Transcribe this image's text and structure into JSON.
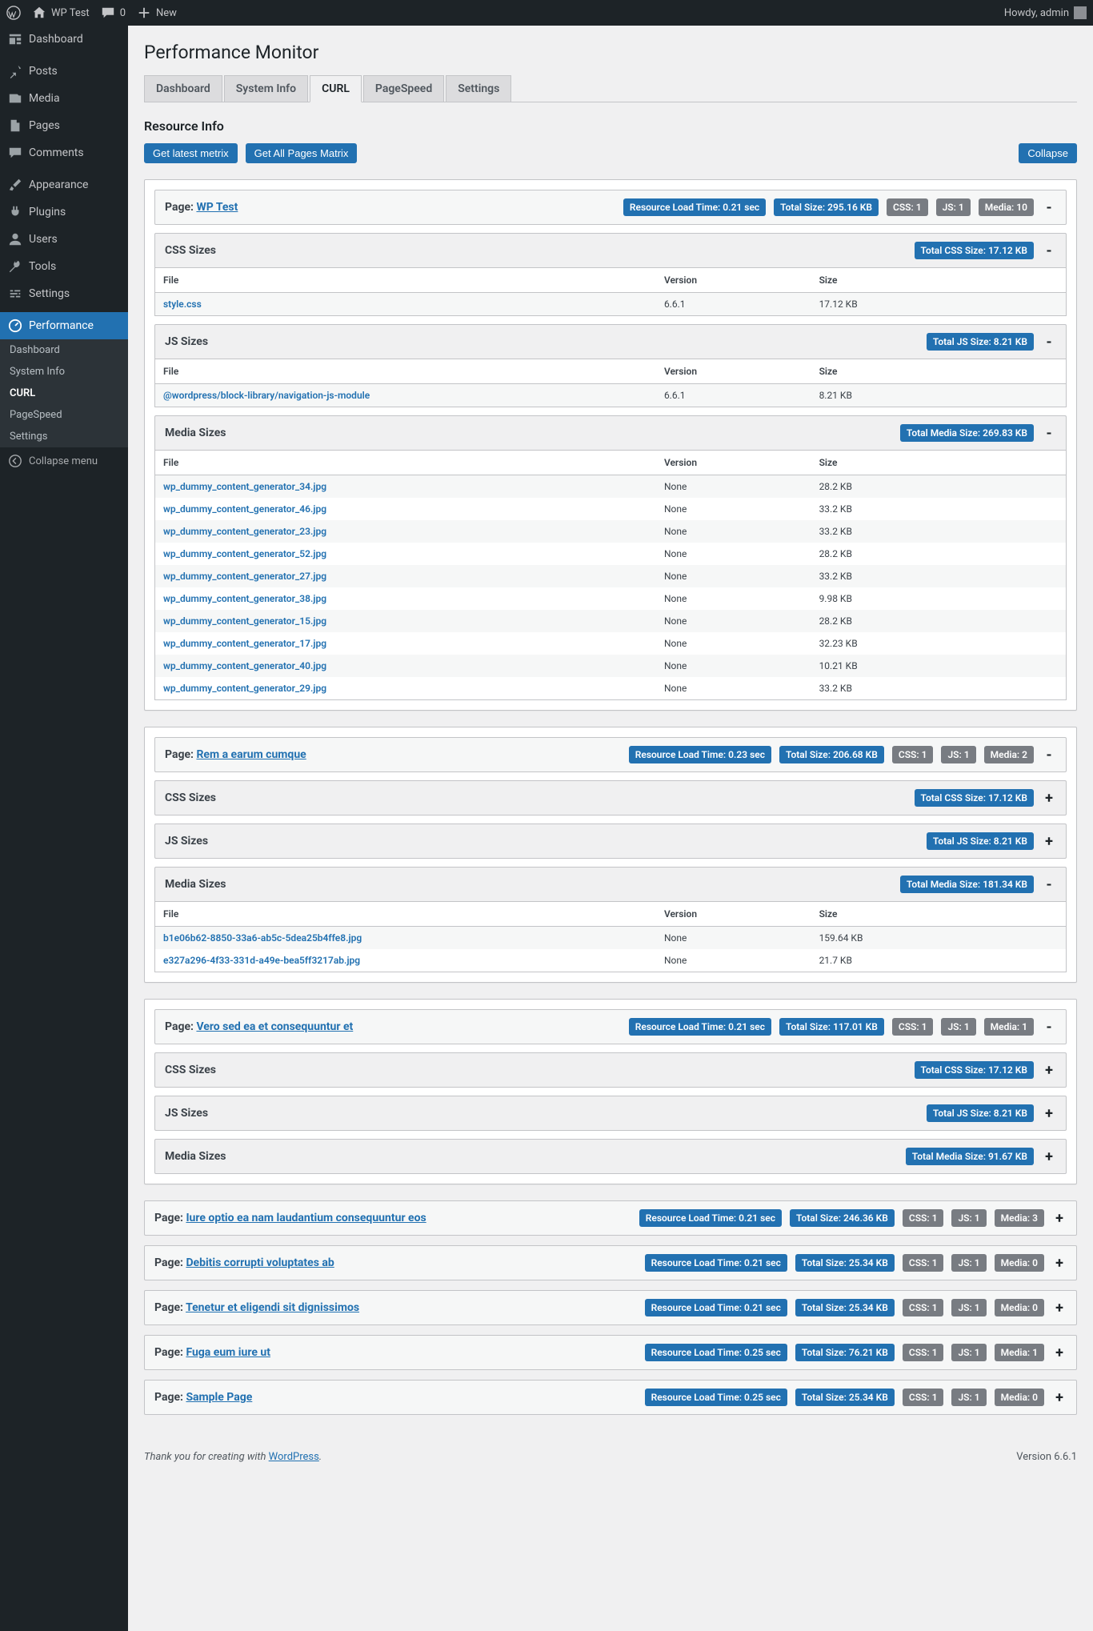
{
  "adminbar": {
    "site_title": "WP Test",
    "comments_count": "0",
    "new_label": "New",
    "howdy": "Howdy, admin"
  },
  "sidebar": {
    "items": [
      {
        "label": "Dashboard",
        "icon": "dashboard"
      },
      {
        "label": "Posts",
        "icon": "pin"
      },
      {
        "label": "Media",
        "icon": "media"
      },
      {
        "label": "Pages",
        "icon": "page"
      },
      {
        "label": "Comments",
        "icon": "comment"
      },
      {
        "label": "Appearance",
        "icon": "brush"
      },
      {
        "label": "Plugins",
        "icon": "plug"
      },
      {
        "label": "Users",
        "icon": "user"
      },
      {
        "label": "Tools",
        "icon": "tool"
      },
      {
        "label": "Settings",
        "icon": "sliders"
      },
      {
        "label": "Performance",
        "icon": "gauge",
        "current": true
      }
    ],
    "submenu": [
      {
        "label": "Dashboard"
      },
      {
        "label": "System Info"
      },
      {
        "label": "CURL",
        "current": true
      },
      {
        "label": "PageSpeed"
      },
      {
        "label": "Settings"
      }
    ],
    "collapse": "Collapse menu"
  },
  "page": {
    "title": "Performance Monitor",
    "tabs": [
      {
        "label": "Dashboard"
      },
      {
        "label": "System Info"
      },
      {
        "label": "CURL",
        "active": true
      },
      {
        "label": "PageSpeed"
      },
      {
        "label": "Settings"
      }
    ],
    "section_title": "Resource Info",
    "btn_latest": "Get latest metrix",
    "btn_matrix": "Get All Pages Matrix",
    "btn_collapse": "Collapse",
    "table_headers": {
      "file": "File",
      "version": "Version",
      "size": "Size"
    },
    "labels": {
      "css": "CSS Sizes",
      "js": "JS Sizes",
      "media": "Media Sizes",
      "page_prefix": "Page:"
    }
  },
  "pages": [
    {
      "name": "WP Test",
      "badges": [
        "Resource Load Time: 0.21 sec",
        "Total Size: 295.16 KB"
      ],
      "grays": [
        "CSS: 1",
        "JS: 1",
        "Media: 10"
      ],
      "toggle": "-",
      "sections": [
        {
          "title": "CSS Sizes",
          "badge": "Total CSS Size: 17.12 KB",
          "toggle": "-",
          "rows": [
            {
              "file": "style.css",
              "version": "6.6.1",
              "size": "17.12 KB"
            }
          ]
        },
        {
          "title": "JS Sizes",
          "badge": "Total JS Size: 8.21 KB",
          "toggle": "-",
          "rows": [
            {
              "file": "@wordpress/block-library/navigation-js-module",
              "version": "6.6.1",
              "size": "8.21 KB"
            }
          ]
        },
        {
          "title": "Media Sizes",
          "badge": "Total Media Size: 269.83 KB",
          "toggle": "-",
          "rows": [
            {
              "file": "wp_dummy_content_generator_34.jpg",
              "version": "None",
              "size": "28.2 KB"
            },
            {
              "file": "wp_dummy_content_generator_46.jpg",
              "version": "None",
              "size": "33.2 KB"
            },
            {
              "file": "wp_dummy_content_generator_23.jpg",
              "version": "None",
              "size": "33.2 KB"
            },
            {
              "file": "wp_dummy_content_generator_52.jpg",
              "version": "None",
              "size": "28.2 KB"
            },
            {
              "file": "wp_dummy_content_generator_27.jpg",
              "version": "None",
              "size": "33.2 KB"
            },
            {
              "file": "wp_dummy_content_generator_38.jpg",
              "version": "None",
              "size": "9.98 KB"
            },
            {
              "file": "wp_dummy_content_generator_15.jpg",
              "version": "None",
              "size": "28.2 KB"
            },
            {
              "file": "wp_dummy_content_generator_17.jpg",
              "version": "None",
              "size": "32.23 KB"
            },
            {
              "file": "wp_dummy_content_generator_40.jpg",
              "version": "None",
              "size": "10.21 KB"
            },
            {
              "file": "wp_dummy_content_generator_29.jpg",
              "version": "None",
              "size": "33.2 KB"
            }
          ]
        }
      ]
    },
    {
      "name": "Rem a earum cumque",
      "badges": [
        "Resource Load Time: 0.23 sec",
        "Total Size: 206.68 KB"
      ],
      "grays": [
        "CSS: 1",
        "JS: 1",
        "Media: 2"
      ],
      "toggle": "-",
      "sections": [
        {
          "title": "CSS Sizes",
          "badge": "Total CSS Size: 17.12 KB",
          "toggle": "+",
          "collapsed": true
        },
        {
          "title": "JS Sizes",
          "badge": "Total JS Size: 8.21 KB",
          "toggle": "+",
          "collapsed": true
        },
        {
          "title": "Media Sizes",
          "badge": "Total Media Size: 181.34 KB",
          "toggle": "-",
          "rows": [
            {
              "file": "b1e06b62-8850-33a6-ab5c-5dea25b4ffe8.jpg",
              "version": "None",
              "size": "159.64 KB"
            },
            {
              "file": "e327a296-4f33-331d-a49e-bea5ff3217ab.jpg",
              "version": "None",
              "size": "21.7 KB"
            }
          ]
        }
      ]
    },
    {
      "name": "Vero sed ea et consequuntur et",
      "badges": [
        "Resource Load Time: 0.21 sec",
        "Total Size: 117.01 KB"
      ],
      "grays": [
        "CSS: 1",
        "JS: 1",
        "Media: 1"
      ],
      "toggle": "-",
      "sections": [
        {
          "title": "CSS Sizes",
          "badge": "Total CSS Size: 17.12 KB",
          "toggle": "+",
          "collapsed": true
        },
        {
          "title": "JS Sizes",
          "badge": "Total JS Size: 8.21 KB",
          "toggle": "+",
          "collapsed": true
        },
        {
          "title": "Media Sizes",
          "badge": "Total Media Size: 91.67 KB",
          "toggle": "+",
          "collapsed": true
        }
      ]
    },
    {
      "name": "Iure optio ea nam laudantium consequuntur eos",
      "badges": [
        "Resource Load Time: 0.21 sec",
        "Total Size: 246.36 KB"
      ],
      "grays": [
        "CSS: 1",
        "JS: 1",
        "Media: 3"
      ],
      "toggle": "+",
      "header_only": true
    },
    {
      "name": "Debitis corrupti voluptates ab",
      "badges": [
        "Resource Load Time: 0.21 sec",
        "Total Size: 25.34 KB"
      ],
      "grays": [
        "CSS: 1",
        "JS: 1",
        "Media: 0"
      ],
      "toggle": "+",
      "header_only": true
    },
    {
      "name": "Tenetur et eligendi sit dignissimos",
      "badges": [
        "Resource Load Time: 0.21 sec",
        "Total Size: 25.34 KB"
      ],
      "grays": [
        "CSS: 1",
        "JS: 1",
        "Media: 0"
      ],
      "toggle": "+",
      "header_only": true
    },
    {
      "name": "Fuga eum iure ut",
      "badges": [
        "Resource Load Time: 0.25 sec",
        "Total Size: 76.21 KB"
      ],
      "grays": [
        "CSS: 1",
        "JS: 1",
        "Media: 1"
      ],
      "toggle": "+",
      "header_only": true
    },
    {
      "name": "Sample Page",
      "badges": [
        "Resource Load Time: 0.25 sec",
        "Total Size: 25.34 KB"
      ],
      "grays": [
        "CSS: 1",
        "JS: 1",
        "Media: 0"
      ],
      "toggle": "+",
      "header_only": true
    }
  ],
  "footer": {
    "text": "Thank you for creating with ",
    "link": "WordPress",
    "version": "Version 6.6.1"
  }
}
